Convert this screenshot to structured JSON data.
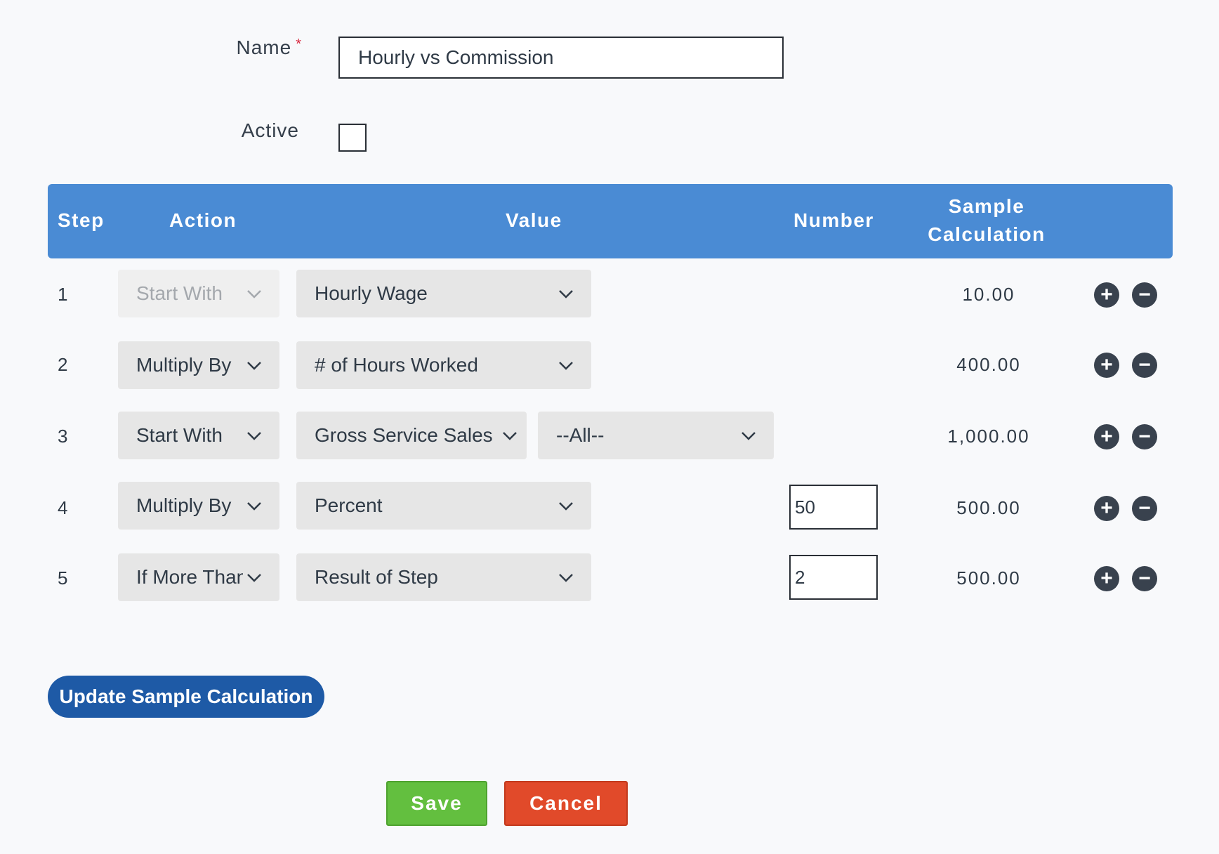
{
  "form": {
    "name_label": "Name",
    "required_mark": "*",
    "name_value": "Hourly vs Commission",
    "active_label": "Active",
    "active_checked": false
  },
  "table": {
    "headers": {
      "step": "Step",
      "action": "Action",
      "value": "Value",
      "number": "Number",
      "sample_line1": "Sample",
      "sample_line2": "Calculation"
    },
    "rows": [
      {
        "step": "1",
        "action": "Start With",
        "action_disabled": true,
        "value": "Hourly Wage",
        "sample": "10.00"
      },
      {
        "step": "2",
        "action": "Multiply By",
        "value": "# of Hours Worked",
        "sample": "400.00"
      },
      {
        "step": "3",
        "action": "Start With",
        "value": "Gross Service Sales",
        "extra": "--All--",
        "sample": "1,000.00"
      },
      {
        "step": "4",
        "action": "Multiply By",
        "value": "Percent",
        "number": "50",
        "sample": "500.00"
      },
      {
        "step": "5",
        "action": "If More Than",
        "value": "Result of Step",
        "number": "2",
        "sample": "500.00"
      }
    ],
    "add_glyph": "+",
    "remove_glyph": "−"
  },
  "buttons": {
    "update": "Update Sample Calculation",
    "save": "Save",
    "cancel": "Cancel"
  },
  "colors": {
    "header_bg": "#4a8bd4",
    "update_bg": "#1e5aa6",
    "save_bg": "#63bf3f",
    "cancel_bg": "#e14a2a",
    "circle_btn": "#39424e"
  },
  "icons": {
    "dropdown": "chevron-down-icon",
    "add": "plus-circle-icon",
    "remove": "minus-circle-icon"
  }
}
